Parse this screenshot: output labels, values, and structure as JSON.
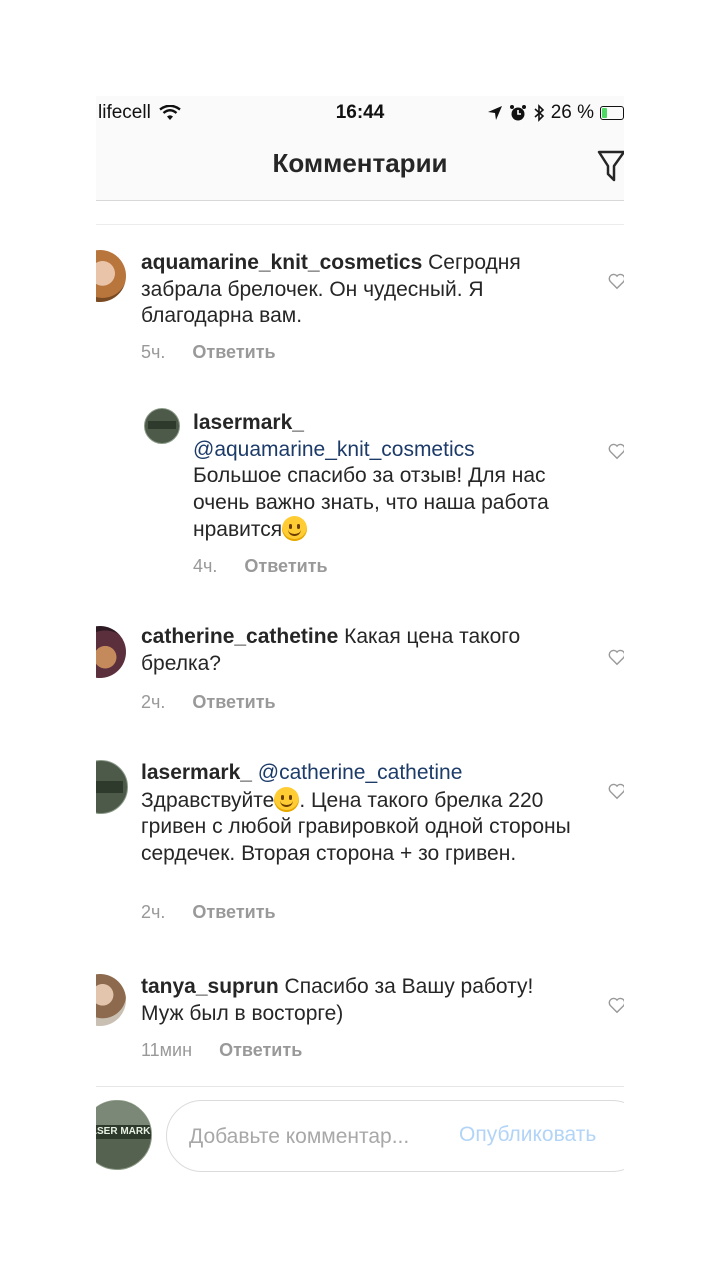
{
  "status": {
    "carrier": "lifecell",
    "time": "16:44",
    "battery": "26 %",
    "battery_level": 0.26
  },
  "header": {
    "title": "Комментарии"
  },
  "comments": [
    {
      "user": "aquamarine_knit_cosmetics",
      "text": "Сегродня забрала брелочек. Он чудесный. Я благодарна вам.",
      "time": "5ч.",
      "reply": "Ответить"
    },
    {
      "user": "lasermark_",
      "mention": "@aquamarine_knit_cosmetics",
      "text": "Большое спасибо за отзыв! Для нас очень важно знать, что наша работа нравится",
      "emoji": "smiling-face",
      "time": "4ч.",
      "reply": "Ответить"
    },
    {
      "user": "catherine_cathetine",
      "text": "Какая цена такого брелка?",
      "time": "2ч.",
      "reply": "Ответить"
    },
    {
      "user": "lasermark_",
      "mention": "@catherine_cathetine",
      "text_before": "Здравствуйте",
      "emoji": "slightly-smiling-face",
      "text_after": ". Цена такого брелка 220 гривен с любой гравировкой одной стороны сердечек. Вторая сторона + зо гривен.",
      "time": "2ч.",
      "reply": "Ответить"
    },
    {
      "user": "tanya_suprun",
      "text": "Спасибо за Вашу работу! Муж был в восторге)",
      "time": "11мин",
      "reply": "Ответить"
    }
  ],
  "composer": {
    "placeholder": "Добавьте комментар...",
    "publish": "Опубликовать"
  },
  "avatar_logo": {
    "line1": "LASER MARK"
  },
  "icons": [
    "wifi-icon",
    "location-arrow-icon",
    "alarm-icon",
    "bluetooth-icon",
    "battery-icon",
    "filter-icon",
    "heart-icon",
    "smiley-emoji-icon"
  ],
  "colors": {
    "mention": "#1d3b69",
    "muted": "#999999",
    "publish": "#b2d4f7",
    "battery": "#4cd964"
  }
}
